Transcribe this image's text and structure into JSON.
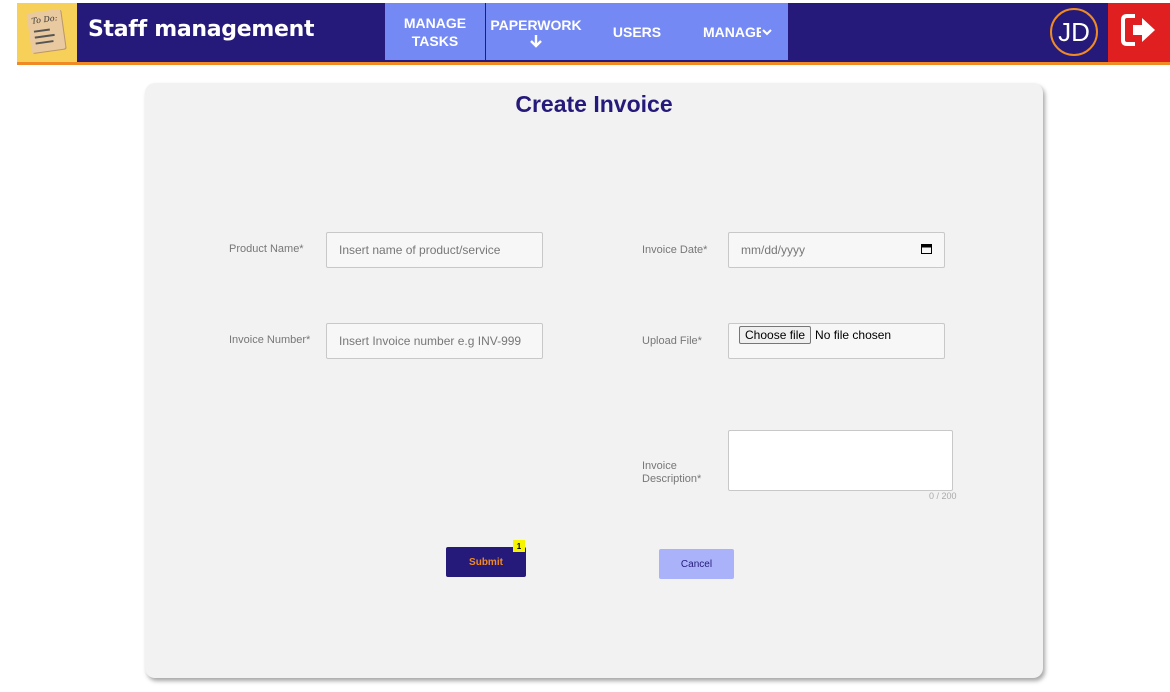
{
  "header": {
    "app_title": "Staff management",
    "logo_note_text": "To Do:",
    "nav": [
      {
        "label_line1": "MANAGE",
        "label_line2": "TASKS"
      },
      {
        "label": "PAPERWORK"
      },
      {
        "label": "USERS"
      },
      {
        "label": "MANAGE"
      }
    ],
    "avatar_initials": "JD"
  },
  "form": {
    "title": "Create Invoice",
    "product_name": {
      "label": "Product Name*",
      "placeholder": "Insert name of product/service"
    },
    "invoice_number": {
      "label": "Invoice Number*",
      "placeholder": "Insert Invoice number e.g INV-999"
    },
    "invoice_date": {
      "label": "Invoice Date*",
      "placeholder": "mm/dd/yyyy"
    },
    "upload_file": {
      "label": "Upload File*",
      "button": "Choose file",
      "status": "No file chosen"
    },
    "description": {
      "label_line1": "Invoice",
      "label_line2": "Description*",
      "counter": "0 / 200"
    },
    "submit_label": "Submit",
    "submit_badge": "1",
    "cancel_label": "Cancel"
  },
  "colors": {
    "primary": "#251a7a",
    "accent": "#f08a24",
    "nav": "#7589f5",
    "logout": "#e02020",
    "cancel": "#aab3fa",
    "badge": "#f6f400"
  },
  "icons": {
    "logo": "todo-note-icon",
    "paperwork": "arrow-down-icon",
    "manage": "chevron-down-icon",
    "logout": "logout-icon",
    "date": "calendar-icon"
  }
}
